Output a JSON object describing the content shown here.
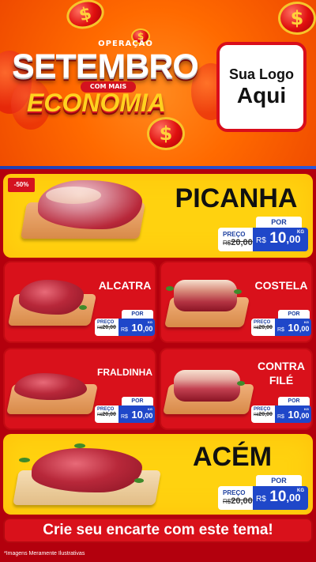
{
  "header": {
    "operacao": "OPERAÇÃO",
    "title": "SETEMBRO",
    "com_mais": "COM MAIS",
    "subtitle": "ECONOMIA",
    "coin_symbol": "$",
    "logo_line1": "Sua Logo",
    "logo_line2": "Aqui"
  },
  "colors": {
    "header_orange": "#ff6a00",
    "card_yellow": "#ffd20f",
    "card_red": "#d9111b",
    "price_blue": "#1f47c9",
    "background_red": "#b3000d"
  },
  "products": [
    {
      "name": "PICANHA",
      "discount": "-50%",
      "por": "POR",
      "preco": "PREÇO",
      "old_prefix": "R$",
      "old_price": "20,00",
      "currency": "R$",
      "price_int": "10",
      "price_dec": ",00",
      "unit": "KG"
    },
    {
      "name": "ALCATRA",
      "por": "POR",
      "preco": "PREÇO",
      "old_prefix": "R$",
      "old_price": "20,00",
      "currency": "R$",
      "price_int": "10",
      "price_dec": ",00",
      "unit": "KG"
    },
    {
      "name": "COSTELA",
      "por": "POR",
      "preco": "PREÇO",
      "old_prefix": "R$",
      "old_price": "20,00",
      "currency": "R$",
      "price_int": "10",
      "price_dec": ",00",
      "unit": "KG"
    },
    {
      "name": "FRALDINHA",
      "por": "POR",
      "preco": "PREÇO",
      "old_prefix": "R$",
      "old_price": "20,00",
      "currency": "R$",
      "price_int": "10",
      "price_dec": ",00",
      "unit": "KG"
    },
    {
      "name_line1": "CONTRA",
      "name_line2": "FILÉ",
      "por": "POR",
      "preco": "PREÇO",
      "old_prefix": "R$",
      "old_price": "20,00",
      "currency": "R$",
      "price_int": "10",
      "price_dec": ",00",
      "unit": "KG"
    },
    {
      "name": "ACÉM",
      "por": "POR",
      "preco": "PREÇO",
      "old_prefix": "R$",
      "old_price": "20,00",
      "currency": "R$",
      "price_int": "10",
      "price_dec": ",00",
      "unit": "KG"
    }
  ],
  "footer": {
    "cta": "Crie seu encarte com este tema!",
    "disclaimer": "*Imagens Meramente Ilustrativas"
  }
}
